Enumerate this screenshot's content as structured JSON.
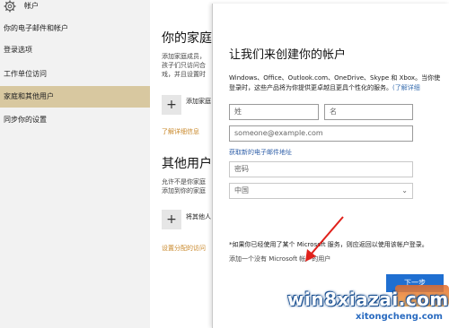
{
  "nav": {
    "title": "帐户",
    "items": [
      {
        "label": "你的电子邮件和帐户"
      },
      {
        "label": "登录选项"
      },
      {
        "label": "工作单位访问"
      },
      {
        "label": "家庭和其他用户",
        "active": true
      },
      {
        "label": "同步你的设置"
      }
    ]
  },
  "family": {
    "heading": "你的家庭",
    "desc_1": "添加家庭成员，",
    "desc_2": "孩子们只访问合",
    "desc_3": "戏，并且设置时",
    "add_label": "添加家庭",
    "learn_more": "了解详细信息"
  },
  "others": {
    "heading": "其他用户",
    "desc_1": "允许不是你家庭",
    "desc_2": "添加到你的家庭",
    "add_label": "将其他人",
    "assigned_access": "设置分配的访问"
  },
  "dialog": {
    "title": "让我们来创建你的帐户",
    "intro_1": "Windows、Office、Outlook.com、OneDrive、Skype 和 Xbox。当你使",
    "intro_2": "登录时，这些产品将为你提供更卓越且更具个性化的服务。",
    "intro_link": "了解详细",
    "lastname_placeholder": "姓",
    "firstname_placeholder": "名",
    "email_placeholder": "someone@example.com",
    "get_email_link": "获取新的电子邮件地址",
    "password_placeholder": "密码",
    "country_value": "中国",
    "note": "*如果你已经使用了某个 Microsoft 服务，则应返回以使用该帐户登录。",
    "no_ms_account_link": "添加一个没有 Microsoft 帐户的用户",
    "next_button": "下一步"
  },
  "watermark": {
    "line1": "win8xiazai.com",
    "line2": "xitongcheng.com"
  }
}
